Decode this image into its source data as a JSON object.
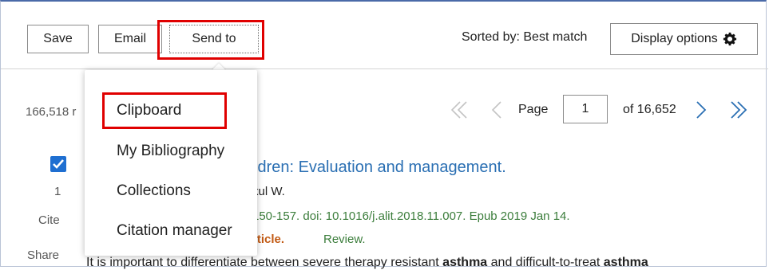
{
  "toolbar": {
    "save_label": "Save",
    "email_label": "Email",
    "send_to_label": "Send to",
    "sorted_by": "Sorted by: Best match",
    "display_options_label": "Display options"
  },
  "results": {
    "count_text": "166,518 r"
  },
  "pagination": {
    "page_label": "Page",
    "current_page": "1",
    "of_label": "of 16,652"
  },
  "send_to_menu": {
    "items": [
      {
        "label": "Clipboard"
      },
      {
        "label": "My Bibliography"
      },
      {
        "label": "Collections"
      },
      {
        "label": "Citation manager"
      }
    ]
  },
  "result_item": {
    "index": "1",
    "cite_label": "Cite",
    "share_label": "Share",
    "title": "ldren: Evaluation and management.",
    "authors": "kul W.",
    "citation": "150-157. doi: 10.1016/j.alit.2018.11.007. Epub 2019 Jan 14.",
    "article_type": "rticle.",
    "review_label": "Review.",
    "snippet_pre": "It is important to differentiate between severe therapy resistant ",
    "snippet_kw1": "asthma",
    "snippet_mid": " and difficult-to-treat ",
    "snippet_kw2": "asthma"
  },
  "colors": {
    "highlight": "#e00000",
    "link": "#2a6fb3",
    "checkbox": "#1f6fd1",
    "journal_green": "#3b7d3b"
  }
}
